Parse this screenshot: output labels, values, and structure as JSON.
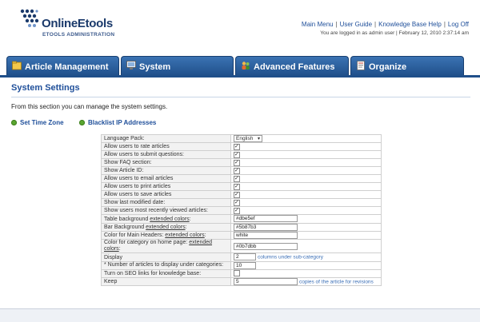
{
  "brand": {
    "name": "OnlineEtools",
    "subtitle": "ETOOLS ADMINISTRATION"
  },
  "topnav": {
    "links": [
      "Main Menu",
      "User Guide",
      "Knowledge Base Help",
      "Log Off"
    ],
    "login_text": "You are logged in as admin user | February 12, 2010 2:37:14 am"
  },
  "tabs": [
    {
      "label": "Article Management",
      "icon": "folder-icon"
    },
    {
      "label": "System",
      "icon": "monitor-icon"
    },
    {
      "label": "Advanced Features",
      "icon": "people-icon"
    },
    {
      "label": "Organize",
      "icon": "document-icon"
    }
  ],
  "page": {
    "title": "System Settings",
    "intro": "From this section you can manage the system settings.",
    "sublinks": [
      "Set Time Zone",
      "Blacklist IP Addresses"
    ]
  },
  "settings": {
    "language_label": "Language Pack:",
    "language_value": "English",
    "checkbox_rows": [
      {
        "label": "Allow users to rate articles",
        "checked": true
      },
      {
        "label": "Allow users to submit questions:",
        "checked": true
      },
      {
        "label": "Show FAQ section:",
        "checked": true
      },
      {
        "label": "Show Article ID:",
        "checked": true
      },
      {
        "label": "Allow users to email articles",
        "checked": true
      },
      {
        "label": "Allow users to print articles",
        "checked": true
      },
      {
        "label": "Allow users to save articles",
        "checked": true
      },
      {
        "label": "Show last modified date:",
        "checked": true
      },
      {
        "label": "Show users most recently viewed articles:",
        "checked": true
      }
    ],
    "table_bg": {
      "label_pre": "Table background ",
      "label_link": "extended colors",
      "label_post": ":",
      "value": "#dbe5ef"
    },
    "bar_bg": {
      "label_pre": "Bar Background ",
      "label_link": "extended colors",
      "label_post": ":",
      "value": "#5b87b3"
    },
    "main_headers": {
      "label_pre": "Color for Main Headers: ",
      "label_link": "extended colors",
      "label_post": ":",
      "value": "white"
    },
    "category_color": {
      "label_pre": "Color for category on home page: ",
      "label_link": "extended colors",
      "label_post": ":",
      "value": "#0b7dbb"
    },
    "display": {
      "label": "Display",
      "value": "2",
      "note": "columns under sub-category"
    },
    "num_articles": {
      "label": "* Number of articles to display under categories:",
      "value": "10"
    },
    "seo": {
      "label": "Turn on SEO links for knowledge base:",
      "checked": false
    },
    "keep": {
      "label": "Keep",
      "value": "5",
      "note": "copies of the article for revisions"
    }
  }
}
